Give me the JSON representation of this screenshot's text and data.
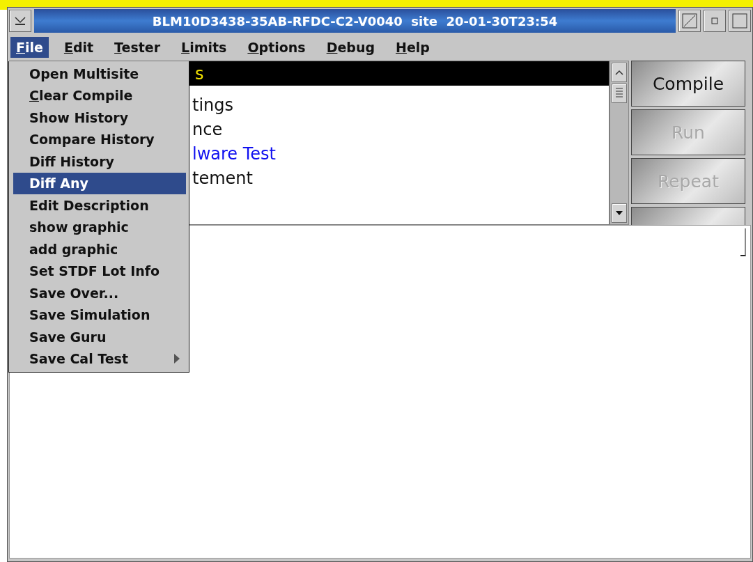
{
  "window": {
    "title": "BLM10D3438-35AB-RFDC-C2-V0040  site  20-01-30T23:54"
  },
  "menu_bar": [
    {
      "label": "File",
      "selected": true,
      "underlined": true
    },
    {
      "label": "Edit",
      "selected": false,
      "underlined": true
    },
    {
      "label": "Tester",
      "selected": false,
      "underlined": true
    },
    {
      "label": "Limits",
      "selected": false,
      "underlined": true
    },
    {
      "label": "Options",
      "selected": false,
      "underlined": true
    },
    {
      "label": "Debug",
      "selected": false,
      "underlined": true
    },
    {
      "label": "Help",
      "selected": false,
      "underlined": true
    }
  ],
  "file_menu": [
    {
      "label": "Open Multisite",
      "selected": false,
      "underlined": false,
      "submenu": false
    },
    {
      "label": "Clear Compile",
      "selected": false,
      "underlined": true,
      "submenu": false
    },
    {
      "label": "Show History",
      "selected": false,
      "underlined": false,
      "submenu": false
    },
    {
      "label": "Compare History",
      "selected": false,
      "underlined": false,
      "submenu": false
    },
    {
      "label": "Diff History",
      "selected": false,
      "underlined": false,
      "submenu": false
    },
    {
      "label": "Diff Any",
      "selected": true,
      "underlined": false,
      "submenu": false
    },
    {
      "label": "Edit Description",
      "selected": false,
      "underlined": false,
      "submenu": false
    },
    {
      "label": "show graphic",
      "selected": false,
      "underlined": false,
      "submenu": false
    },
    {
      "label": "add graphic",
      "selected": false,
      "underlined": false,
      "submenu": false
    },
    {
      "label": "Set STDF Lot Info",
      "selected": false,
      "underlined": false,
      "submenu": false
    },
    {
      "label": "Save Over...",
      "selected": false,
      "underlined": false,
      "submenu": false
    },
    {
      "label": "Save Simulation",
      "selected": false,
      "underlined": false,
      "submenu": false
    },
    {
      "label": "Save Guru",
      "selected": false,
      "underlined": false,
      "submenu": false
    },
    {
      "label": "Save Cal Test",
      "selected": false,
      "underlined": false,
      "submenu": true
    }
  ],
  "test_list": [
    {
      "label": "s",
      "kind": "header"
    },
    {
      "label": "tings",
      "kind": "item"
    },
    {
      "label": "nce",
      "kind": "item"
    },
    {
      "label": "lware Test",
      "kind": "current"
    },
    {
      "label": "tement",
      "kind": "item"
    }
  ],
  "buttons": [
    {
      "label": "Compile",
      "disabled": false
    },
    {
      "label": "Run",
      "disabled": true
    },
    {
      "label": "Repeat",
      "disabled": true
    }
  ]
}
